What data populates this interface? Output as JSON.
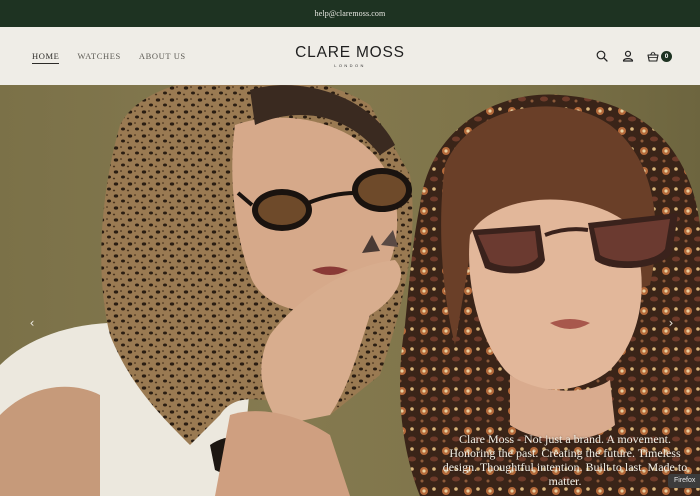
{
  "announcement": {
    "email": "help@claremoss.com"
  },
  "nav": {
    "items": [
      {
        "label": "HOME",
        "active": true
      },
      {
        "label": "WATCHES",
        "active": false
      },
      {
        "label": "ABOUT US",
        "active": false
      }
    ]
  },
  "brand": {
    "name": "CLARE MOSS",
    "location": "LONDON"
  },
  "header_icons": [
    "search-icon",
    "account-icon",
    "basket-icon"
  ],
  "cart": {
    "count": "0"
  },
  "hero": {
    "prev_glyph": "‹",
    "next_glyph": "›",
    "caption": "Clare Moss - Not just a brand. A movement. Honoring the past. Creating the future. Timeless design. Thoughtful intention. Built to last. Made to matter."
  },
  "browser_tab": {
    "label": "Firefox"
  },
  "colors": {
    "topbar": "#1e3322",
    "header_bg": "#efede7",
    "badge": "#1e3322",
    "hero_bg": "#857a50"
  }
}
